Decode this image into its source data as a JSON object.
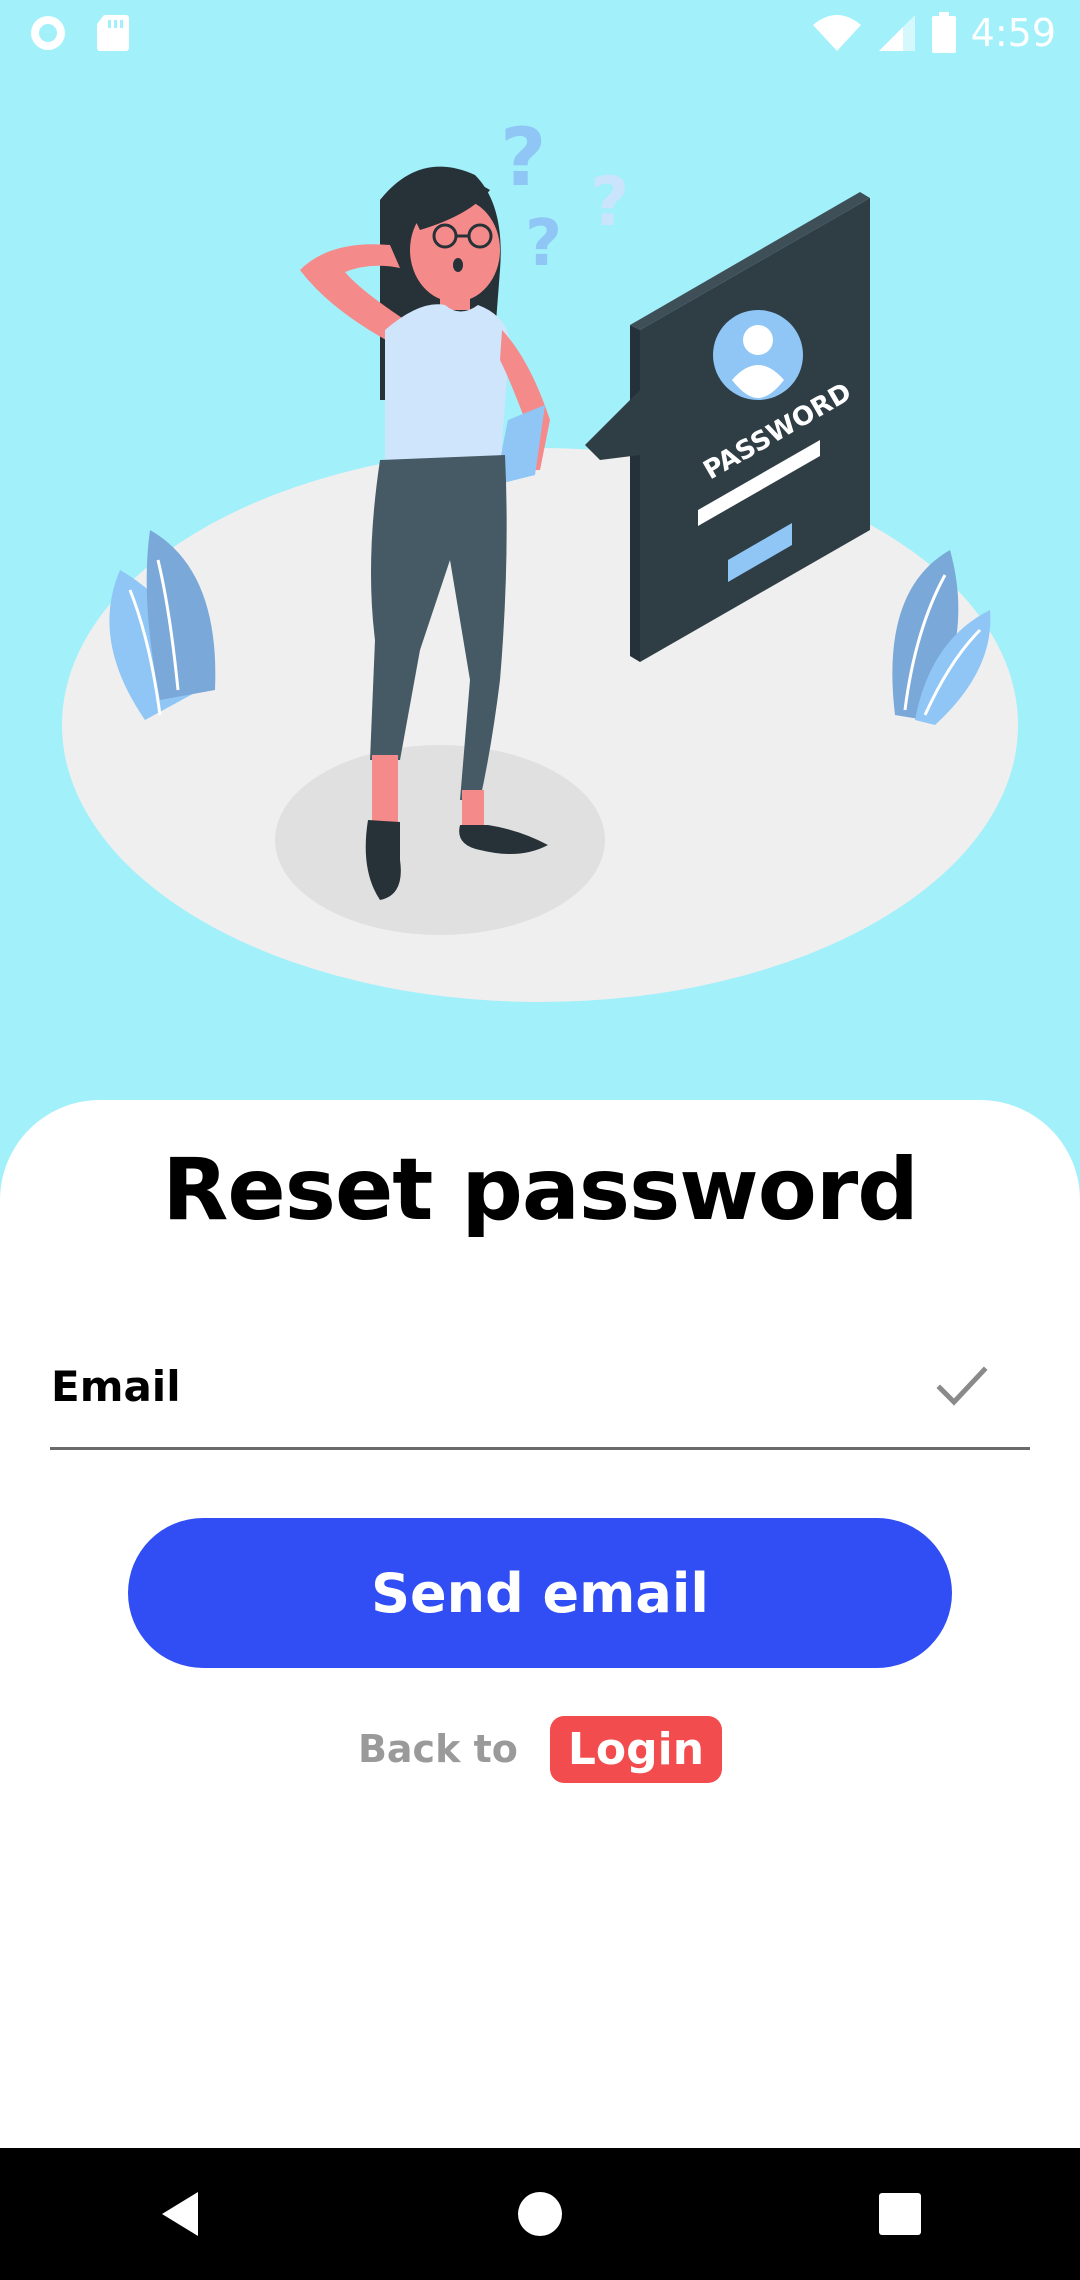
{
  "status_bar": {
    "time": "4:59",
    "icons": [
      "circle-notification-icon",
      "sd-card-icon",
      "wifi-icon",
      "signal-icon",
      "battery-icon"
    ]
  },
  "hero": {
    "illustration": "confused-woman-forgot-password-illustration",
    "panel_text": "PASSWORD"
  },
  "form": {
    "title": "Reset password",
    "email_label": "Email",
    "email_value": "",
    "check_icon": "check-icon",
    "send_button_label": "Send email",
    "back_text": "Back to",
    "login_label": "Login"
  },
  "colors": {
    "background": "#a2f0fa",
    "primary_button": "#304ef3",
    "login_badge": "#f24c4f"
  },
  "nav_bar": {
    "icons": [
      "back-icon",
      "home-icon",
      "recents-icon"
    ]
  }
}
